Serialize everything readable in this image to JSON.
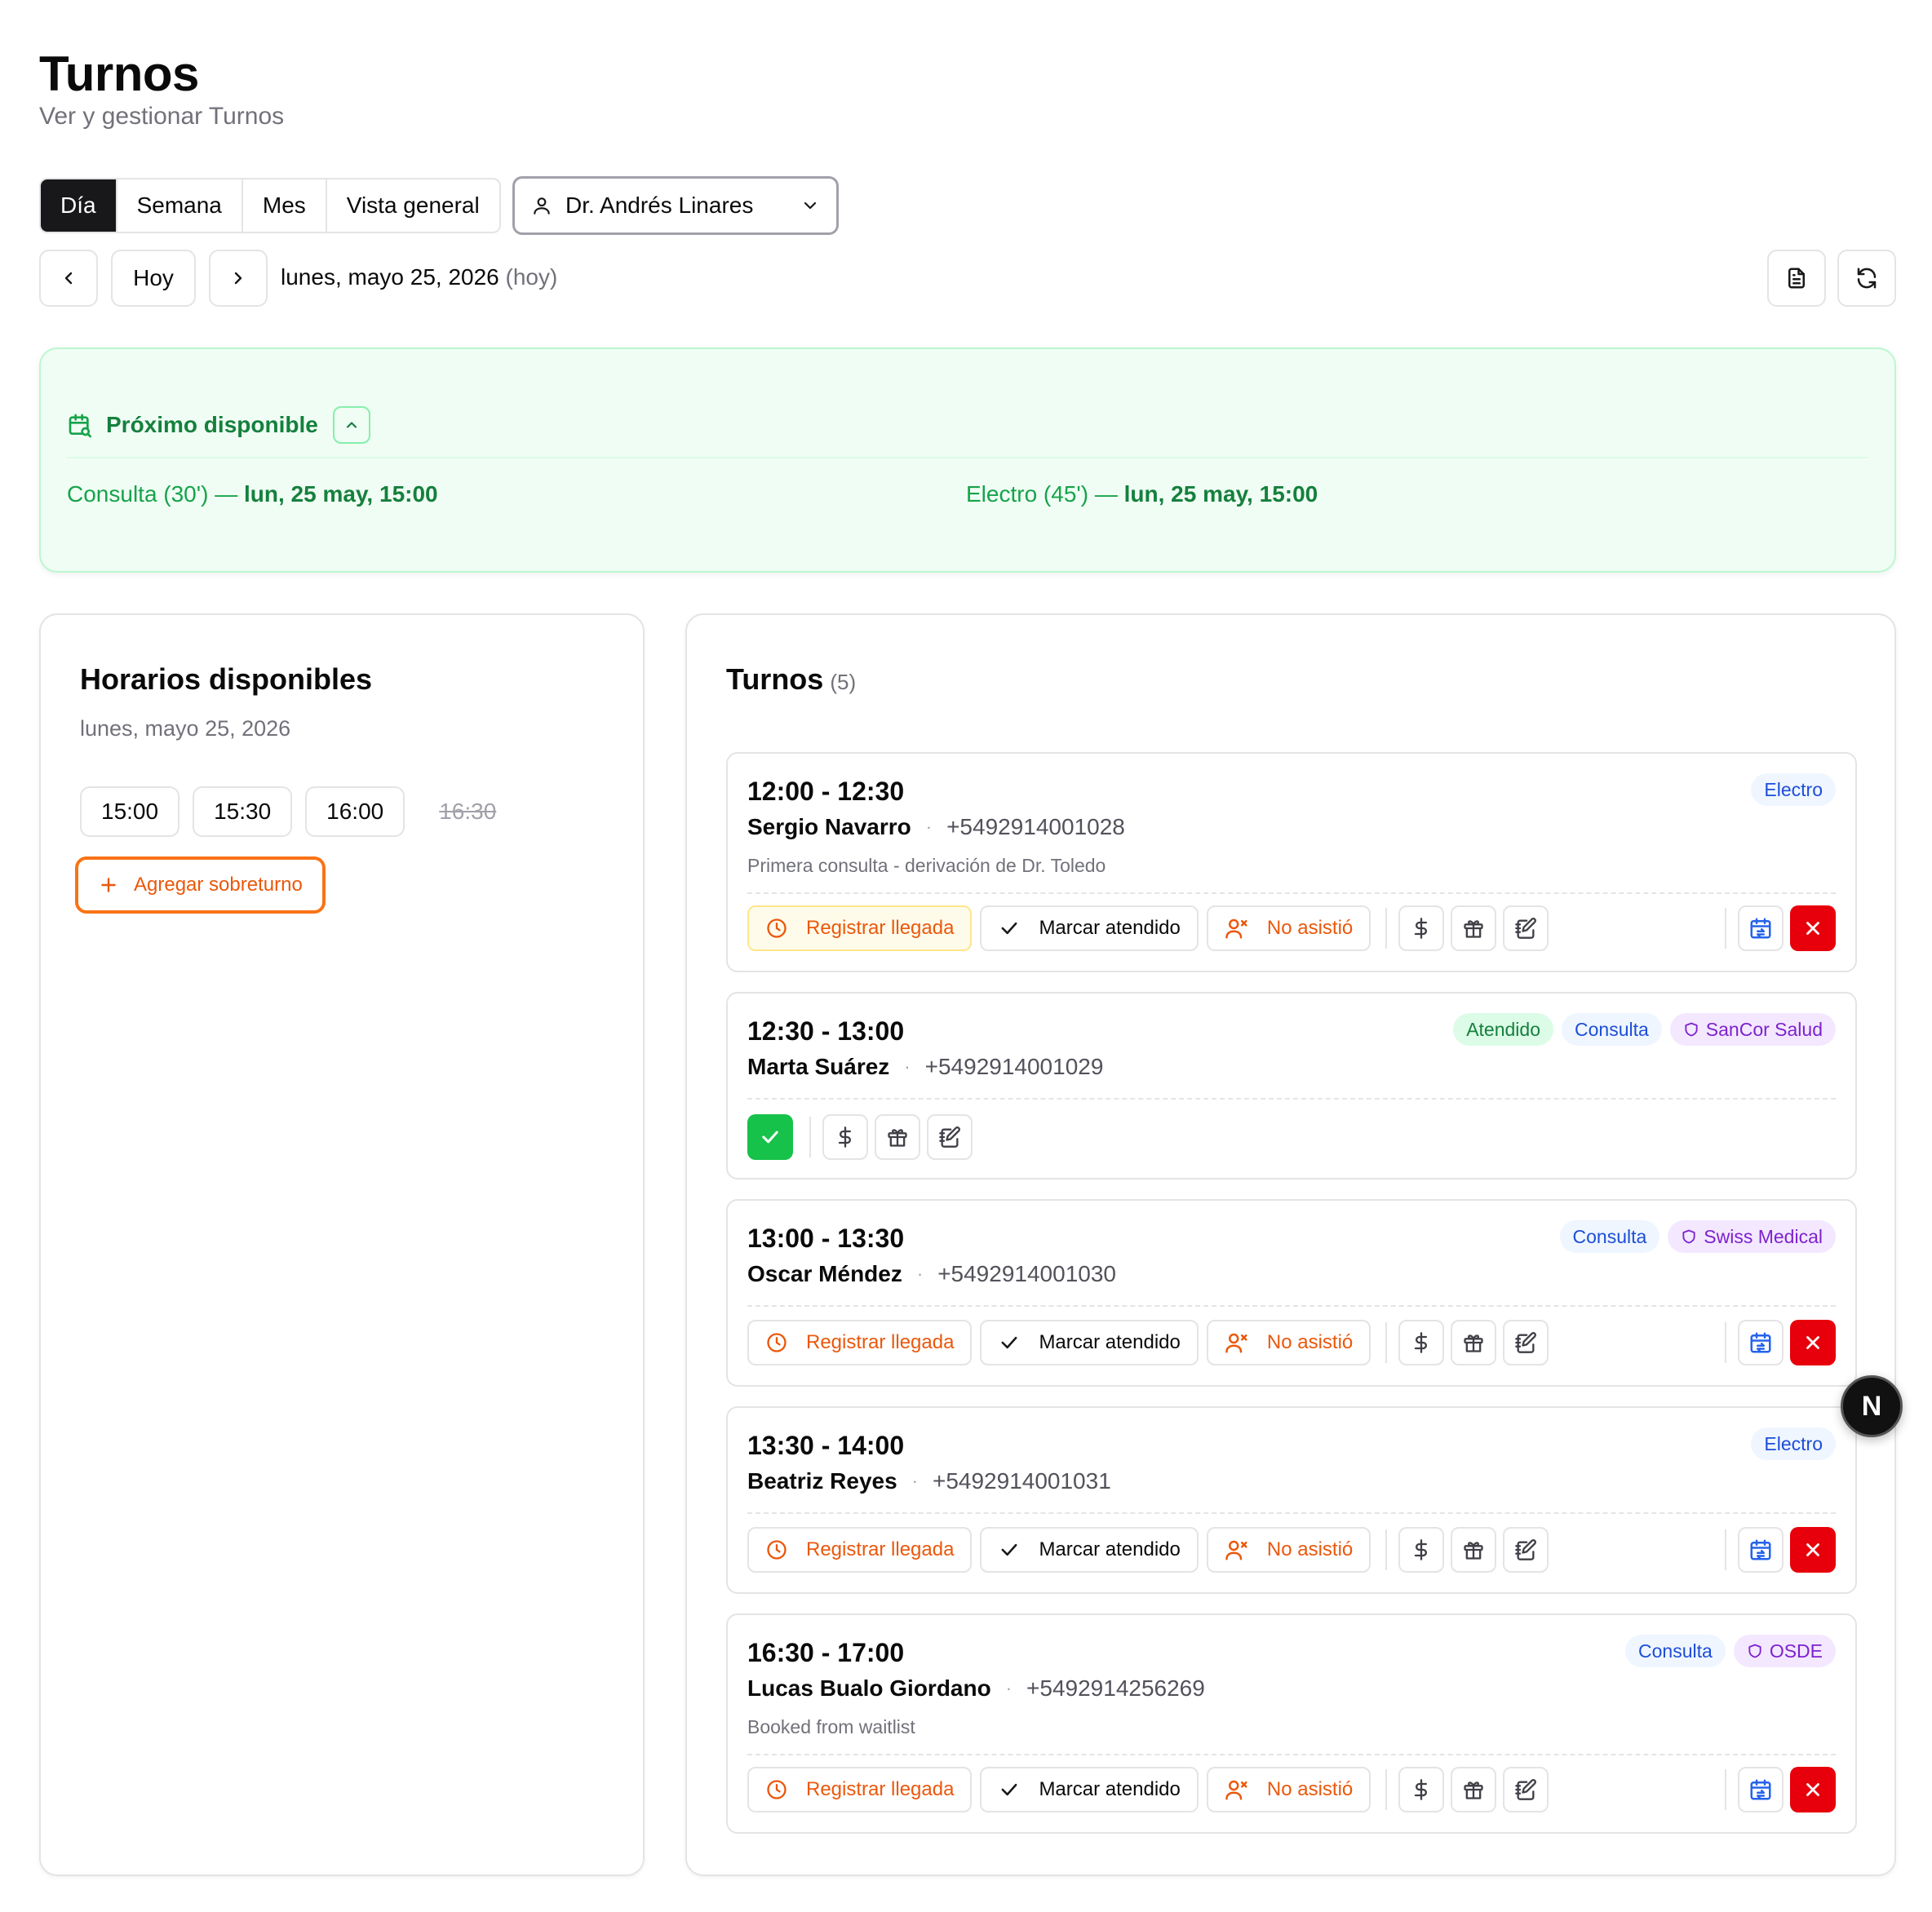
{
  "header": {
    "title": "Turnos",
    "subtitle": "Ver y gestionar Turnos"
  },
  "view_tabs": [
    "Día",
    "Semana",
    "Mes",
    "Vista general"
  ],
  "active_view": "Día",
  "doctor_select": {
    "value": "Dr. Andrés Linares"
  },
  "date_nav": {
    "today_label": "Hoy",
    "date": "lunes, mayo 25, 2026",
    "today_hint": "(hoy)"
  },
  "next_available": {
    "title": "Próximo disponible",
    "items": [
      {
        "label": "Consulta (30')",
        "sep": "—",
        "when": "lun, 25 may, 15:00"
      },
      {
        "label": "Electro (45')",
        "sep": "—",
        "when": "lun, 25 may, 15:00"
      }
    ]
  },
  "slots": {
    "title": "Horarios disponibles",
    "date": "lunes, mayo 25, 2026",
    "times": [
      "15:00",
      "15:30",
      "16:00"
    ],
    "taken": [
      "16:30"
    ],
    "overbook_label": "Agregar sobreturno"
  },
  "appointments": {
    "title": "Turnos",
    "count": "(5)",
    "actions": {
      "arrival": "Registrar llegada",
      "attended": "Marcar atendido",
      "no_show": "No asistió"
    },
    "items": [
      {
        "time": "12:00 - 12:30",
        "name": "Sergio Navarro",
        "phone": "+5492914001028",
        "note": "Primera consulta - derivación de Dr. Toledo",
        "badges": [
          {
            "text": "Electro",
            "kind": "blue"
          }
        ]
      },
      {
        "time": "12:30 - 13:00",
        "name": "Marta Suárez",
        "phone": "+5492914001029",
        "note": "",
        "badges": [
          {
            "text": "Atendido",
            "kind": "green"
          },
          {
            "text": "Consulta",
            "kind": "blue"
          },
          {
            "text": "SanCor Salud",
            "kind": "purple"
          }
        ]
      },
      {
        "time": "13:00 - 13:30",
        "name": "Oscar Méndez",
        "phone": "+5492914001030",
        "note": "",
        "badges": [
          {
            "text": "Consulta",
            "kind": "blue"
          },
          {
            "text": "Swiss Medical",
            "kind": "purple"
          }
        ]
      },
      {
        "time": "13:30 - 14:00",
        "name": "Beatriz Reyes",
        "phone": "+5492914001031",
        "note": "",
        "badges": [
          {
            "text": "Electro",
            "kind": "blue"
          }
        ]
      },
      {
        "time": "16:30 - 17:00",
        "name": "Lucas Bualo Giordano",
        "phone": "+5492914256269",
        "note": "Booked from waitlist",
        "badges": [
          {
            "text": "Consulta",
            "kind": "blue"
          },
          {
            "text": "OSDE",
            "kind": "purple"
          }
        ]
      }
    ]
  },
  "floating_badge": "N"
}
